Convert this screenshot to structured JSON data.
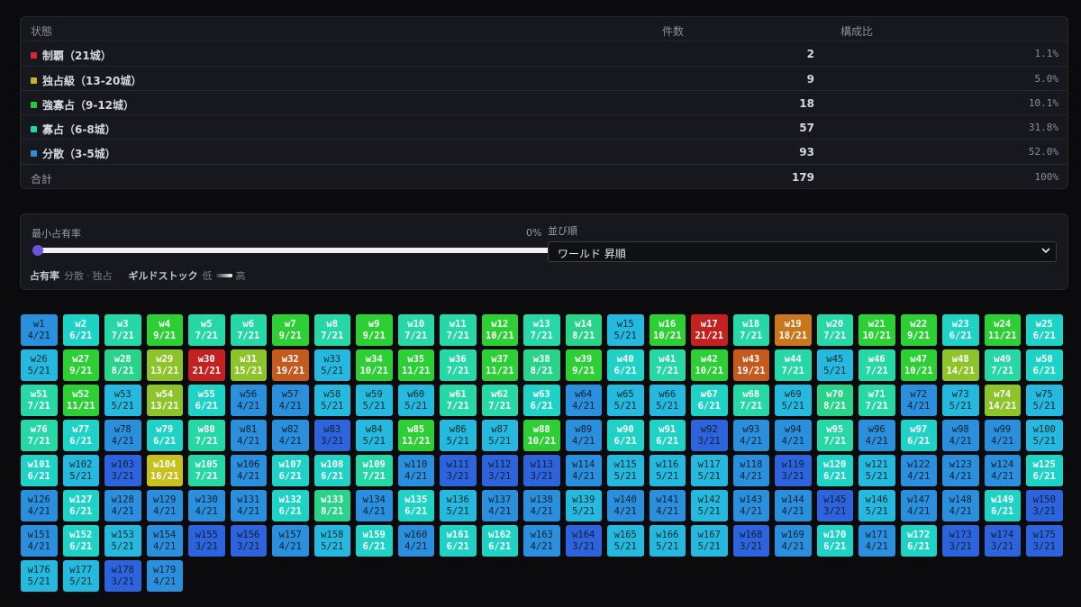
{
  "table": {
    "headers": {
      "state": "状態",
      "count": "件数",
      "ratio": "構成比"
    },
    "rows": [
      {
        "label": "制覇（21城）",
        "count": "2",
        "ratio": "1.1%",
        "color": "#d42a2a"
      },
      {
        "label": "独占級（13-20城）",
        "count": "9",
        "ratio": "5.0%",
        "color": "#c8b21f"
      },
      {
        "label": "強寡占（9-12城）",
        "count": "18",
        "ratio": "10.1%",
        "color": "#2bc63a"
      },
      {
        "label": "寡占（6-8城）",
        "count": "57",
        "ratio": "31.8%",
        "color": "#23d3b4"
      },
      {
        "label": "分散（3-5城）",
        "count": "93",
        "ratio": "52.0%",
        "color": "#2a8fd6"
      }
    ],
    "total": {
      "label": "合計",
      "count": "179",
      "ratio": "100%"
    }
  },
  "controls": {
    "min_share_label": "最小占有率",
    "min_share_value": "0%",
    "min_share_level": 0,
    "sort_label": "並び順",
    "sort_value": "ワールド 昇順",
    "legend": {
      "share_label": "占有率",
      "share_low": "分散",
      "sep": "·",
      "share_high": "独占",
      "stock_label": "ギルドストック",
      "stock_low": "低",
      "stock_high": "高"
    }
  },
  "worlds": [
    [
      "w1",
      "4/21"
    ],
    [
      "w2",
      "6/21"
    ],
    [
      "w3",
      "7/21"
    ],
    [
      "w4",
      "9/21"
    ],
    [
      "w5",
      "7/21"
    ],
    [
      "w6",
      "7/21"
    ],
    [
      "w7",
      "9/21"
    ],
    [
      "w8",
      "7/21"
    ],
    [
      "w9",
      "9/21"
    ],
    [
      "w10",
      "7/21"
    ],
    [
      "w11",
      "7/21"
    ],
    [
      "w12",
      "10/21"
    ],
    [
      "w13",
      "7/21"
    ],
    [
      "w14",
      "8/21"
    ],
    [
      "w15",
      "5/21"
    ],
    [
      "w16",
      "10/21"
    ],
    [
      "w17",
      "21/21"
    ],
    [
      "w18",
      "7/21"
    ],
    [
      "w19",
      "18/21"
    ],
    [
      "w20",
      "7/21"
    ],
    [
      "w21",
      "10/21"
    ],
    [
      "w22",
      "9/21"
    ],
    [
      "w23",
      "6/21"
    ],
    [
      "w24",
      "11/21"
    ],
    [
      "w25",
      "6/21"
    ],
    [
      "w26",
      "5/21"
    ],
    [
      "w27",
      "9/21"
    ],
    [
      "w28",
      "8/21"
    ],
    [
      "w29",
      "13/21"
    ],
    [
      "w30",
      "21/21"
    ],
    [
      "w31",
      "15/21"
    ],
    [
      "w32",
      "19/21"
    ],
    [
      "w33",
      "5/21"
    ],
    [
      "w34",
      "10/21"
    ],
    [
      "w35",
      "11/21"
    ],
    [
      "w36",
      "7/21"
    ],
    [
      "w37",
      "11/21"
    ],
    [
      "w38",
      "8/21"
    ],
    [
      "w39",
      "9/21"
    ],
    [
      "w40",
      "6/21"
    ],
    [
      "w41",
      "7/21"
    ],
    [
      "w42",
      "10/21"
    ],
    [
      "w43",
      "19/21"
    ],
    [
      "w44",
      "7/21"
    ],
    [
      "w45",
      "5/21"
    ],
    [
      "w46",
      "7/21"
    ],
    [
      "w47",
      "10/21"
    ],
    [
      "w48",
      "14/21"
    ],
    [
      "w49",
      "7/21"
    ],
    [
      "w50",
      "6/21"
    ],
    [
      "w51",
      "7/21"
    ],
    [
      "w52",
      "11/21"
    ],
    [
      "w53",
      "5/21"
    ],
    [
      "w54",
      "13/21"
    ],
    [
      "w55",
      "6/21"
    ],
    [
      "w56",
      "4/21"
    ],
    [
      "w57",
      "4/21"
    ],
    [
      "w58",
      "5/21"
    ],
    [
      "w59",
      "5/21"
    ],
    [
      "w60",
      "5/21"
    ],
    [
      "w61",
      "7/21"
    ],
    [
      "w62",
      "7/21"
    ],
    [
      "w63",
      "6/21"
    ],
    [
      "w64",
      "4/21"
    ],
    [
      "w65",
      "5/21"
    ],
    [
      "w66",
      "5/21"
    ],
    [
      "w67",
      "6/21"
    ],
    [
      "w68",
      "7/21"
    ],
    [
      "w69",
      "5/21"
    ],
    [
      "w70",
      "8/21"
    ],
    [
      "w71",
      "7/21"
    ],
    [
      "w72",
      "4/21"
    ],
    [
      "w73",
      "5/21"
    ],
    [
      "w74",
      "14/21"
    ],
    [
      "w75",
      "5/21"
    ],
    [
      "w76",
      "7/21"
    ],
    [
      "w77",
      "6/21"
    ],
    [
      "w78",
      "4/21"
    ],
    [
      "w79",
      "6/21"
    ],
    [
      "w80",
      "7/21"
    ],
    [
      "w81",
      "4/21"
    ],
    [
      "w82",
      "4/21"
    ],
    [
      "w83",
      "3/21"
    ],
    [
      "w84",
      "5/21"
    ],
    [
      "w85",
      "11/21"
    ],
    [
      "w86",
      "5/21"
    ],
    [
      "w87",
      "5/21"
    ],
    [
      "w88",
      "10/21"
    ],
    [
      "w89",
      "4/21"
    ],
    [
      "w90",
      "6/21"
    ],
    [
      "w91",
      "6/21"
    ],
    [
      "w92",
      "3/21"
    ],
    [
      "w93",
      "4/21"
    ],
    [
      "w94",
      "4/21"
    ],
    [
      "w95",
      "7/21"
    ],
    [
      "w96",
      "4/21"
    ],
    [
      "w97",
      "6/21"
    ],
    [
      "w98",
      "4/21"
    ],
    [
      "w99",
      "4/21"
    ],
    [
      "w100",
      "5/21"
    ],
    [
      "w101",
      "6/21"
    ],
    [
      "w102",
      "5/21"
    ],
    [
      "w103",
      "3/21"
    ],
    [
      "w104",
      "16/21"
    ],
    [
      "w105",
      "7/21"
    ],
    [
      "w106",
      "4/21"
    ],
    [
      "w107",
      "6/21"
    ],
    [
      "w108",
      "6/21"
    ],
    [
      "w109",
      "7/21"
    ],
    [
      "w110",
      "4/21"
    ],
    [
      "w111",
      "3/21"
    ],
    [
      "w112",
      "3/21"
    ],
    [
      "w113",
      "3/21"
    ],
    [
      "w114",
      "4/21"
    ],
    [
      "w115",
      "5/21"
    ],
    [
      "w116",
      "5/21"
    ],
    [
      "w117",
      "5/21"
    ],
    [
      "w118",
      "4/21"
    ],
    [
      "w119",
      "3/21"
    ],
    [
      "w120",
      "6/21"
    ],
    [
      "w121",
      "5/21"
    ],
    [
      "w122",
      "4/21"
    ],
    [
      "w123",
      "4/21"
    ],
    [
      "w124",
      "4/21"
    ],
    [
      "w125",
      "6/21"
    ],
    [
      "w126",
      "4/21"
    ],
    [
      "w127",
      "6/21"
    ],
    [
      "w128",
      "4/21"
    ],
    [
      "w129",
      "4/21"
    ],
    [
      "w130",
      "4/21"
    ],
    [
      "w131",
      "4/21"
    ],
    [
      "w132",
      "6/21"
    ],
    [
      "w133",
      "8/21"
    ],
    [
      "w134",
      "4/21"
    ],
    [
      "w135",
      "6/21"
    ],
    [
      "w136",
      "5/21"
    ],
    [
      "w137",
      "4/21"
    ],
    [
      "w138",
      "4/21"
    ],
    [
      "w139",
      "5/21"
    ],
    [
      "w140",
      "4/21"
    ],
    [
      "w141",
      "4/21"
    ],
    [
      "w142",
      "5/21"
    ],
    [
      "w143",
      "4/21"
    ],
    [
      "w144",
      "4/21"
    ],
    [
      "w145",
      "3/21"
    ],
    [
      "w146",
      "5/21"
    ],
    [
      "w147",
      "4/21"
    ],
    [
      "w148",
      "4/21"
    ],
    [
      "w149",
      "6/21"
    ],
    [
      "w150",
      "3/21"
    ],
    [
      "w151",
      "4/21"
    ],
    [
      "w152",
      "6/21"
    ],
    [
      "w153",
      "5/21"
    ],
    [
      "w154",
      "4/21"
    ],
    [
      "w155",
      "3/21"
    ],
    [
      "w156",
      "3/21"
    ],
    [
      "w157",
      "4/21"
    ],
    [
      "w158",
      "5/21"
    ],
    [
      "w159",
      "6/21"
    ],
    [
      "w160",
      "4/21"
    ],
    [
      "w161",
      "6/21"
    ],
    [
      "w162",
      "6/21"
    ],
    [
      "w163",
      "4/21"
    ],
    [
      "w164",
      "3/21"
    ],
    [
      "w165",
      "5/21"
    ],
    [
      "w166",
      "5/21"
    ],
    [
      "w167",
      "5/21"
    ],
    [
      "w168",
      "3/21"
    ],
    [
      "w169",
      "4/21"
    ],
    [
      "w170",
      "6/21"
    ],
    [
      "w171",
      "4/21"
    ],
    [
      "w172",
      "6/21"
    ],
    [
      "w173",
      "3/21"
    ],
    [
      "w174",
      "3/21"
    ],
    [
      "w175",
      "3/21"
    ],
    [
      "w176",
      "5/21"
    ],
    [
      "w177",
      "5/21"
    ],
    [
      "w178",
      "3/21"
    ],
    [
      "w179",
      "4/21"
    ]
  ]
}
